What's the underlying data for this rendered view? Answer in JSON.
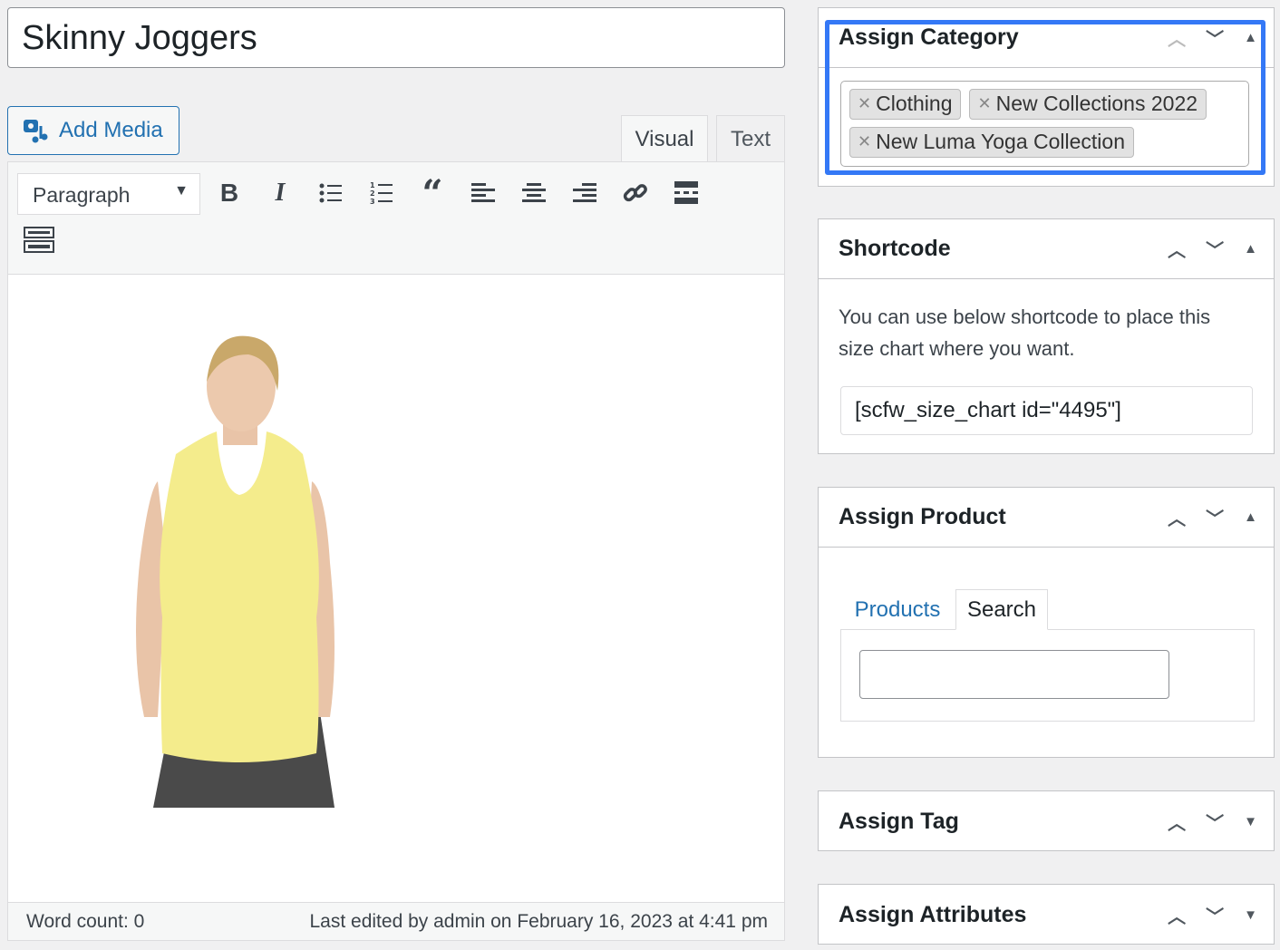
{
  "post": {
    "title": "Skinny Joggers"
  },
  "editor": {
    "add_media": "Add Media",
    "tabs": [
      "Visual",
      "Text"
    ],
    "format_select": "Paragraph",
    "toolbar_icons": [
      "bold-icon",
      "italic-icon",
      "bulleted-list-icon",
      "numbered-list-icon",
      "blockquote-icon",
      "align-left-icon",
      "align-center-icon",
      "align-right-icon",
      "link-icon",
      "read-more-icon",
      "toolbar-toggle-icon"
    ],
    "word_count": "Word count: 0",
    "last_edited": "Last edited by admin on February 16, 2023 at 4:41 pm"
  },
  "sidebar": {
    "category": {
      "title": "Assign Category",
      "chips": [
        "Clothing",
        "New Collections 2022",
        "New Luma Yoga Collection"
      ],
      "highlight_color": "#3478f6"
    },
    "shortcode": {
      "title": "Shortcode",
      "description": "You can use below shortcode to place this size chart where you want.",
      "value": "[scfw_size_chart id=\"4495\"]"
    },
    "product": {
      "title": "Assign Product",
      "tabs": [
        "Products",
        "Search"
      ],
      "search_value": ""
    },
    "tag": {
      "title": "Assign Tag"
    },
    "attributes": {
      "title": "Assign Attributes"
    }
  },
  "colors": {
    "accent": "#2271b1"
  }
}
